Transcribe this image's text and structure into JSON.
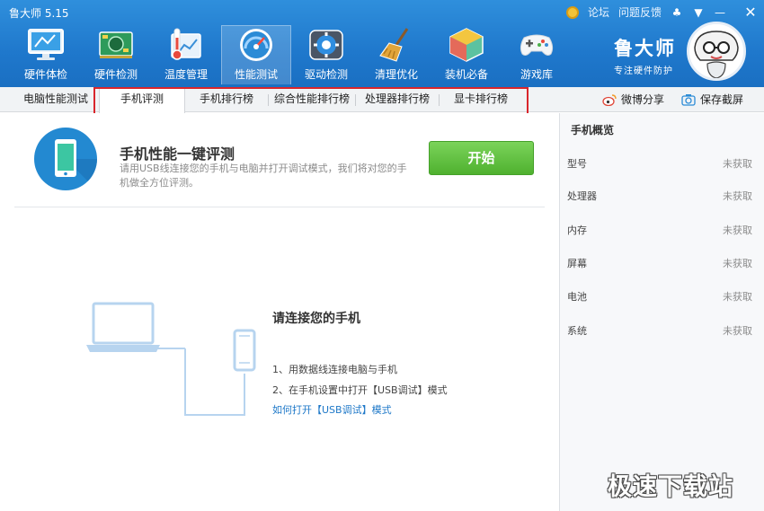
{
  "window": {
    "title": "鲁大师 5.15",
    "links": [
      "论坛",
      "问题反馈"
    ],
    "controls": [
      "shirt-icon",
      "menu-icon",
      "minimize-icon",
      "close-icon"
    ]
  },
  "toolbar": {
    "items": [
      {
        "label": "硬件体检",
        "icon": "monitor-icon"
      },
      {
        "label": "硬件检测",
        "icon": "circuit-board-icon"
      },
      {
        "label": "温度管理",
        "icon": "thermometer-icon"
      },
      {
        "label": "性能测试",
        "icon": "speedometer-icon",
        "active": true
      },
      {
        "label": "驱动检测",
        "icon": "gear-box-icon"
      },
      {
        "label": "清理优化",
        "icon": "broom-icon"
      },
      {
        "label": "装机必备",
        "icon": "cube-icon"
      },
      {
        "label": "游戏库",
        "icon": "gamepad-icon"
      }
    ]
  },
  "brand": {
    "name": "鲁大师",
    "slogan": "专注硬件防护"
  },
  "subtabs": {
    "items": [
      "电脑性能测试",
      "手机评测",
      "手机排行榜",
      "综合性能排行榜",
      "处理器排行榜",
      "显卡排行榜"
    ],
    "selected": "手机评测",
    "weibo_share": "微博分享",
    "save_screenshot": "保存截屏"
  },
  "eval": {
    "title": "手机性能一键评测",
    "description": "请用USB线连接您的手机与电脑并打开调试模式，我们将对您的手机做全方位评测。",
    "start_label": "开始"
  },
  "connect": {
    "title": "请连接您的手机",
    "steps": [
      "1、用数据线连接电脑与手机",
      "2、在手机设置中打开【USB调试】模式"
    ],
    "howto_link": "如何打开【USB调试】模式"
  },
  "overview": {
    "title": "手机概览",
    "rows": [
      {
        "label": "型号",
        "value": "未获取"
      },
      {
        "label": "处理器",
        "value": "未获取"
      },
      {
        "label": "内存",
        "value": "未获取"
      },
      {
        "label": "屏幕",
        "value": "未获取"
      },
      {
        "label": "电池",
        "value": "未获取"
      },
      {
        "label": "系统",
        "value": "未获取"
      }
    ]
  },
  "watermark": "极速下载站",
  "colors": {
    "header_blue": "#1f78cc",
    "start_green": "#5cbf3a",
    "link_blue": "#1e78c8",
    "highlight_red": "#d9262c"
  }
}
